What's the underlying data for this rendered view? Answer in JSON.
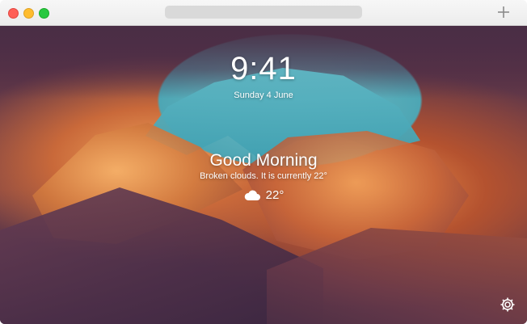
{
  "window": {
    "controls": [
      "close",
      "minimize",
      "maximize"
    ],
    "new_tab_icon": "plus-icon"
  },
  "newtab_page": {
    "time": "9:41",
    "date": "Sunday 4 June",
    "greeting": "Good Morning",
    "weather_summary": "Broken clouds. It is currently 22°",
    "temperature": "22°",
    "weather_icon": "cloud-icon",
    "settings_icon": "gear-icon"
  }
}
